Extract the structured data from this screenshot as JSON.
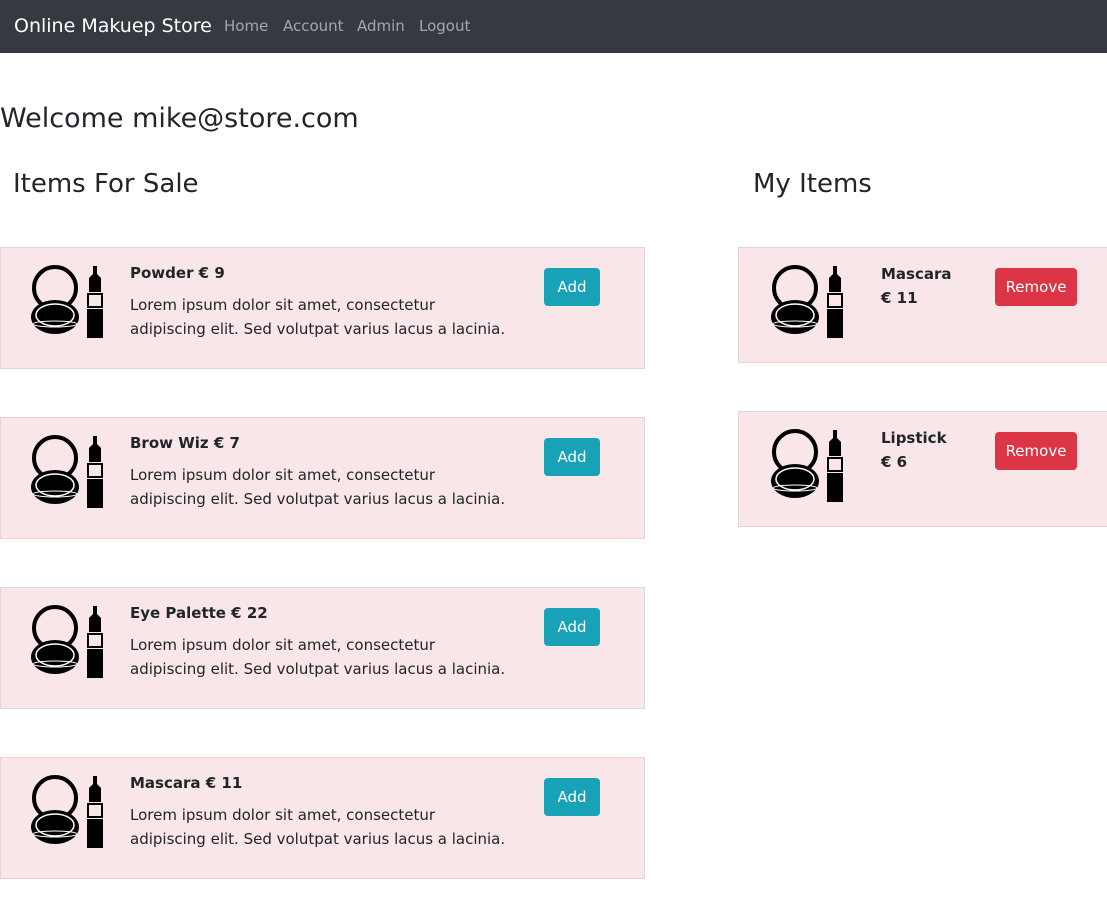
{
  "navbar": {
    "brand": "Online Makuep Store",
    "links": [
      "Home",
      "Account",
      "Admin",
      "Logout"
    ]
  },
  "welcome": "Welcome mike@store.com",
  "for_sale": {
    "title": "Items For Sale",
    "items": [
      {
        "name": "Powder",
        "price": "€ 9",
        "title": "Powder € 9",
        "description": "Lorem ipsum dolor sit amet, consectetur adipiscing elit. Sed volutpat varius lacus a lacinia.",
        "button": "Add",
        "icon": "makeup-compact-lipstick-icon"
      },
      {
        "name": "Brow Wiz",
        "price": "€ 7",
        "title": "Brow Wiz € 7",
        "description": "Lorem ipsum dolor sit amet, consectetur adipiscing elit. Sed volutpat varius lacus a lacinia.",
        "button": "Add",
        "icon": "makeup-compact-lipstick-icon"
      },
      {
        "name": "Eye Palette",
        "price": "€ 22",
        "title": "Eye Palette € 22",
        "description": "Lorem ipsum dolor sit amet, consectetur adipiscing elit. Sed volutpat varius lacus a lacinia.",
        "button": "Add",
        "icon": "makeup-compact-lipstick-icon"
      },
      {
        "name": "Mascara",
        "price": "€ 11",
        "title": "Mascara € 11",
        "description": "Lorem ipsum dolor sit amet, consectetur adipiscing elit. Sed volutpat varius lacus a lacinia.",
        "button": "Add",
        "icon": "makeup-compact-lipstick-icon"
      }
    ]
  },
  "my_items": {
    "title": "My Items",
    "items": [
      {
        "name": "Mascara",
        "price": "€ 11",
        "button": "Remove",
        "icon": "makeup-compact-lipstick-icon"
      },
      {
        "name": "Lipstick",
        "price": "€ 6",
        "button": "Remove",
        "icon": "makeup-compact-lipstick-icon"
      }
    ]
  },
  "colors": {
    "navbar_bg": "#343a40",
    "card_bg": "#f9e6e8",
    "add_button": "#17a2b8",
    "remove_button": "#dc3545"
  }
}
